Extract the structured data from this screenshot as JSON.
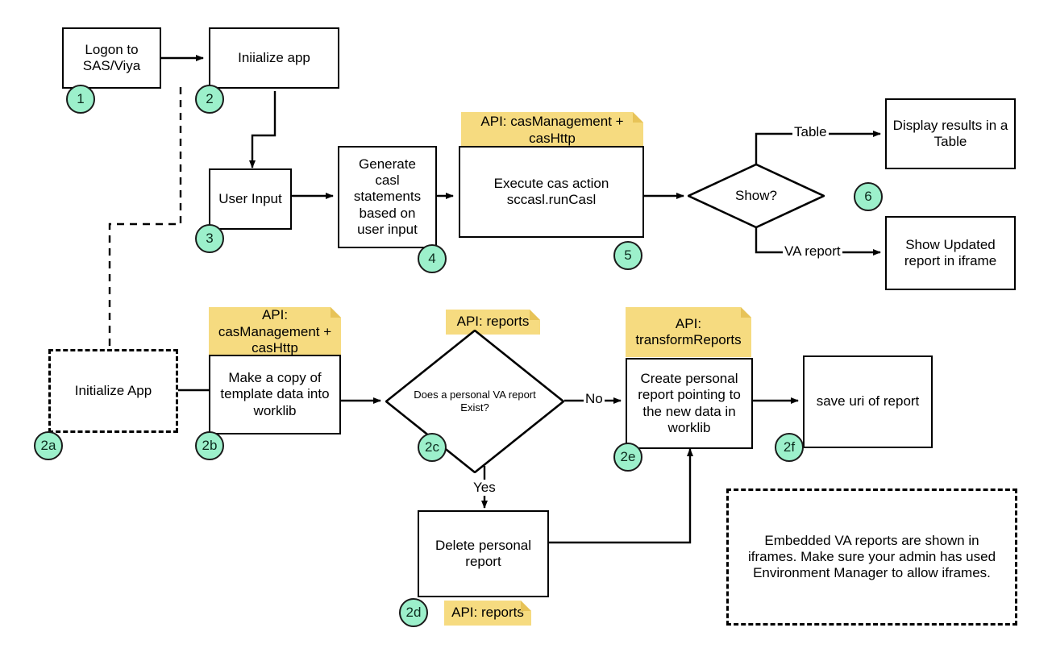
{
  "diagram": {
    "title": "SAS Viya app flow",
    "colors": {
      "badge_fill": "#9cf0cb",
      "note_fill": "#f6db80",
      "note_fold": "#e7c358",
      "stroke": "#000000",
      "node_fill": "#ffffff"
    },
    "nodes": [
      {
        "id": "logon",
        "label": "Logon to\nSAS/Viya",
        "shape": "rect"
      },
      {
        "id": "init_app",
        "label": "Iniialize app",
        "shape": "rect"
      },
      {
        "id": "user_input",
        "label": "User Input",
        "shape": "rect"
      },
      {
        "id": "gen_casl",
        "label": "Generate\ncasl\nstatements\nbased on\nuser input",
        "shape": "rect"
      },
      {
        "id": "exec_cas",
        "label": "Execute cas action\nsccasl.runCasl",
        "shape": "rect"
      },
      {
        "id": "show",
        "label": "Show?",
        "shape": "diamond"
      },
      {
        "id": "display_tbl",
        "label": "Display results in a\nTable",
        "shape": "rect"
      },
      {
        "id": "show_iframe",
        "label": "Show Updated\nreport in iframe",
        "shape": "rect"
      },
      {
        "id": "initialize",
        "label": "Initialize App",
        "shape": "rect-dashed"
      },
      {
        "id": "copy_tmpl",
        "label": "Make a copy of\ntemplate data into\nworklib",
        "shape": "rect"
      },
      {
        "id": "exists",
        "label": "Does a personal VA report\nExist?",
        "shape": "diamond"
      },
      {
        "id": "create_rpt",
        "label": "Create personal\nreport pointing to\nthe new data in\nworklib",
        "shape": "rect"
      },
      {
        "id": "save_uri",
        "label": "save uri of report",
        "shape": "rect"
      },
      {
        "id": "delete_rpt",
        "label": "Delete personal\nreport",
        "shape": "rect"
      },
      {
        "id": "iframe_note",
        "label": "Embedded VA reports are shown in\niframes. Make sure your admin has used\nEnvironment Manager to allow iframes.",
        "shape": "rect-dashed"
      }
    ],
    "badges": [
      {
        "id": "b1",
        "label": "1"
      },
      {
        "id": "b2",
        "label": "2"
      },
      {
        "id": "b3",
        "label": "3"
      },
      {
        "id": "b4",
        "label": "4"
      },
      {
        "id": "b5",
        "label": "5"
      },
      {
        "id": "b6",
        "label": "6"
      },
      {
        "id": "b2a",
        "label": "2a"
      },
      {
        "id": "b2b",
        "label": "2b"
      },
      {
        "id": "b2c",
        "label": "2c"
      },
      {
        "id": "b2d",
        "label": "2d"
      },
      {
        "id": "b2e",
        "label": "2e"
      },
      {
        "id": "b2f",
        "label": "2f"
      }
    ],
    "notes": [
      {
        "id": "note_exec",
        "label": "API: casManagement +\ncasHttp"
      },
      {
        "id": "note_copy",
        "label": "API:\ncasManagement +\ncasHttp"
      },
      {
        "id": "note_exists",
        "label": "API: reports"
      },
      {
        "id": "note_create",
        "label": "API:\ntransformReports"
      },
      {
        "id": "note_delete",
        "label": "API: reports"
      }
    ],
    "edge_labels": [
      {
        "id": "lbl_table",
        "label": "Table"
      },
      {
        "id": "lbl_va_report",
        "label": "VA report"
      },
      {
        "id": "lbl_no",
        "label": "No"
      },
      {
        "id": "lbl_yes",
        "label": "Yes"
      }
    ]
  }
}
